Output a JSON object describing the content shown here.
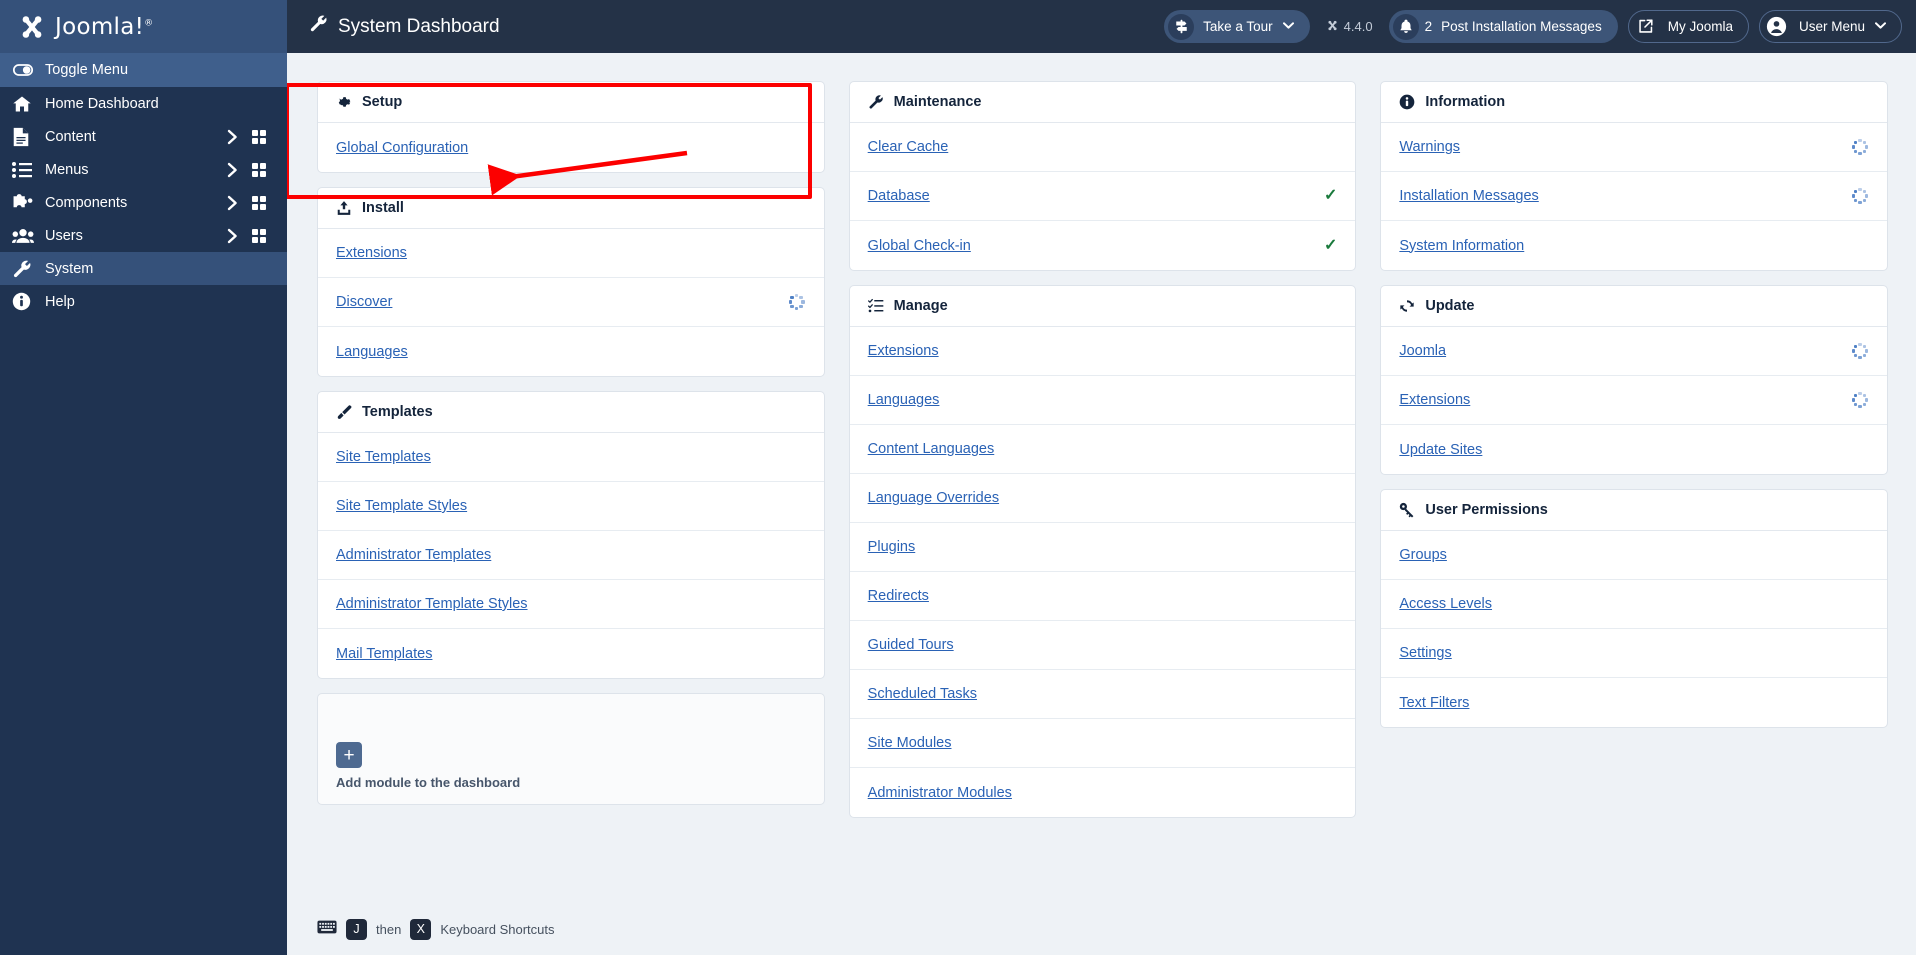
{
  "brand": {
    "name": "Joomla!",
    "registered": "®",
    "logo_icon": "joomla-logo-icon"
  },
  "sidebar": {
    "items": [
      {
        "label": "Toggle Menu",
        "icon": "toggle-icon",
        "state": "toggle",
        "chevron": false,
        "grid": false
      },
      {
        "label": "Home Dashboard",
        "icon": "home-icon",
        "state": "",
        "chevron": false,
        "grid": false
      },
      {
        "label": "Content",
        "icon": "document-icon",
        "state": "",
        "chevron": true,
        "grid": true
      },
      {
        "label": "Menus",
        "icon": "list-icon",
        "state": "",
        "chevron": true,
        "grid": true
      },
      {
        "label": "Components",
        "icon": "puzzle-icon",
        "state": "",
        "chevron": true,
        "grid": true
      },
      {
        "label": "Users",
        "icon": "users-icon",
        "state": "",
        "chevron": true,
        "grid": true
      },
      {
        "label": "System",
        "icon": "wrench-icon",
        "state": "active",
        "chevron": false,
        "grid": false
      },
      {
        "label": "Help",
        "icon": "info-icon",
        "state": "",
        "chevron": false,
        "grid": false
      }
    ]
  },
  "topbar": {
    "title": "System Dashboard",
    "title_icon": "wrench-icon",
    "take_a_tour": {
      "label": "Take a Tour",
      "icon": "signpost-icon",
      "caret": "⌄"
    },
    "version": {
      "label": "4.4.0",
      "icon": "joomla-mark-icon"
    },
    "post_install": {
      "label": "Post Installation Messages",
      "count": "2",
      "icon": "bell-icon"
    },
    "my_joomla": {
      "label": "My Joomla",
      "icon": "external-link-icon"
    },
    "user_menu": {
      "label": "User Menu",
      "icon": "user-circle-icon",
      "caret": "⌄"
    }
  },
  "columns": [
    {
      "cards": [
        {
          "title": "Setup",
          "icon": "gear-icon",
          "rows": [
            {
              "label": "Global Configuration",
              "status": ""
            }
          ]
        },
        {
          "title": "Install",
          "icon": "upload-icon",
          "rows": [
            {
              "label": "Extensions",
              "status": ""
            },
            {
              "label": "Discover",
              "status": "spinner"
            },
            {
              "label": "Languages",
              "status": ""
            }
          ]
        },
        {
          "title": "Templates",
          "icon": "brush-icon",
          "rows": [
            {
              "label": "Site Templates",
              "status": ""
            },
            {
              "label": "Site Template Styles",
              "status": ""
            },
            {
              "label": "Administrator Templates",
              "status": ""
            },
            {
              "label": "Administrator Template Styles",
              "status": ""
            },
            {
              "label": "Mail Templates",
              "status": ""
            }
          ]
        }
      ],
      "add_module": {
        "label": "Add module to the dashboard",
        "icon": "plus-icon"
      }
    },
    {
      "cards": [
        {
          "title": "Maintenance",
          "icon": "wrench-icon",
          "rows": [
            {
              "label": "Clear Cache",
              "status": ""
            },
            {
              "label": "Database",
              "status": "check"
            },
            {
              "label": "Global Check-in",
              "status": "check"
            }
          ]
        },
        {
          "title": "Manage",
          "icon": "checklist-icon",
          "rows": [
            {
              "label": "Extensions",
              "status": ""
            },
            {
              "label": "Languages",
              "status": ""
            },
            {
              "label": "Content Languages",
              "status": ""
            },
            {
              "label": "Language Overrides",
              "status": ""
            },
            {
              "label": "Plugins",
              "status": ""
            },
            {
              "label": "Redirects",
              "status": ""
            },
            {
              "label": "Guided Tours",
              "status": ""
            },
            {
              "label": "Scheduled Tasks",
              "status": ""
            },
            {
              "label": "Site Modules",
              "status": ""
            },
            {
              "label": "Administrator Modules",
              "status": ""
            }
          ]
        }
      ],
      "add_module": null
    },
    {
      "cards": [
        {
          "title": "Information",
          "icon": "info-icon",
          "rows": [
            {
              "label": "Warnings",
              "status": "spinner"
            },
            {
              "label": "Installation Messages",
              "status": "spinner"
            },
            {
              "label": "System Information",
              "status": ""
            }
          ]
        },
        {
          "title": "Update",
          "icon": "refresh-icon",
          "rows": [
            {
              "label": "Joomla",
              "status": "spinner"
            },
            {
              "label": "Extensions",
              "status": "spinner"
            },
            {
              "label": "Update Sites",
              "status": ""
            }
          ]
        },
        {
          "title": "User Permissions",
          "icon": "key-icon",
          "rows": [
            {
              "label": "Groups",
              "status": ""
            },
            {
              "label": "Access Levels",
              "status": ""
            },
            {
              "label": "Settings",
              "status": ""
            },
            {
              "label": "Text Filters",
              "status": ""
            }
          ]
        }
      ],
      "add_module": null
    }
  ],
  "footer": {
    "icon": "keyboard-icon",
    "key1": "J",
    "then": "then",
    "key2": "X",
    "label": "Keyboard Shortcuts"
  },
  "annotation": {
    "highlight_color": "#fc0000",
    "target": "Global Configuration"
  },
  "colors": {
    "sidebar_bg": "#1f3351",
    "topbar_bg": "#243247",
    "content_bg": "#eef2f6",
    "link": "#2a62b5",
    "check": "#1a7a3c",
    "annotation": "#fc0000"
  }
}
